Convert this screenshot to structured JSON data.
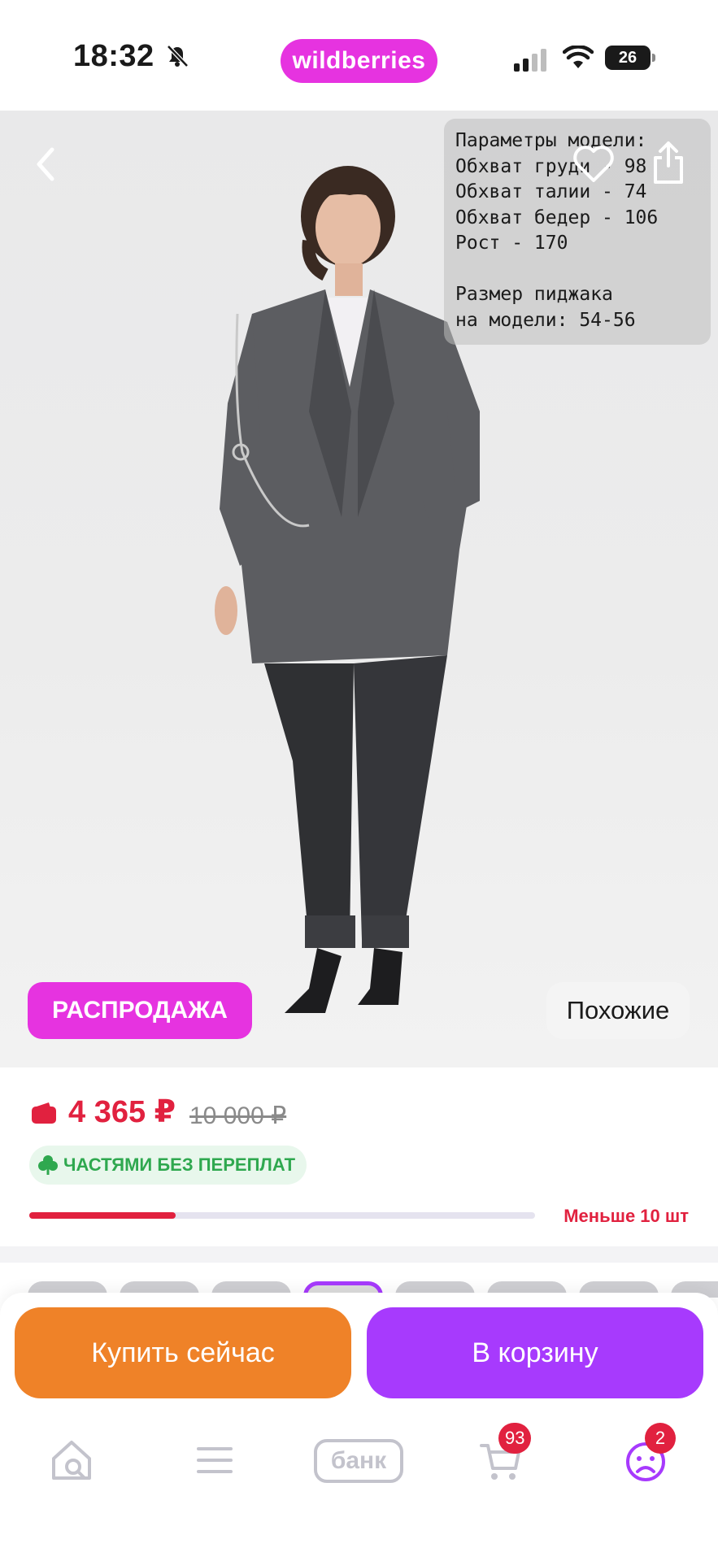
{
  "status_bar": {
    "time": "18:32",
    "brand": "wildberries",
    "battery": "26",
    "icons": [
      "bell-muted-icon",
      "signal-icon",
      "wifi-icon",
      "battery-icon"
    ]
  },
  "hero": {
    "model_params": "Параметры модели:\nОбхват груди - 98\nОбхват талии - 74\nОбхват бедер - 106\nРост - 170\n\nРазмер пиджака\nна модели: 54-56",
    "sale_badge": "РАСПРОДАЖА",
    "similar_label": "Похожие",
    "icons": [
      "back-icon",
      "heart-icon",
      "share-icon"
    ]
  },
  "price": {
    "current": "4 365 ₽",
    "old": "10 000 ₽",
    "installment": "ЧАСТЯМИ БЕЗ ПЕРЕПЛАТ",
    "stock_label": "Меньше 10 шт",
    "stock_level": 0.29,
    "colors": {
      "price": "#e1213f",
      "installment": "#2fa84f"
    }
  },
  "thumbnails": {
    "count": 8,
    "active_index": 3
  },
  "actions": {
    "buy_now": "Купить сейчас",
    "add_to_cart": "В корзину",
    "colors": {
      "buy_now": "#ef8228",
      "add_to_cart": "#a73afd"
    }
  },
  "tabbar": {
    "bank_label": "банк",
    "cart_badge": "93",
    "profile_badge": "2",
    "icons": [
      "home-search-icon",
      "menu-icon",
      "bank-icon",
      "cart-icon",
      "profile-icon"
    ]
  },
  "brand_color": "#e633e0"
}
